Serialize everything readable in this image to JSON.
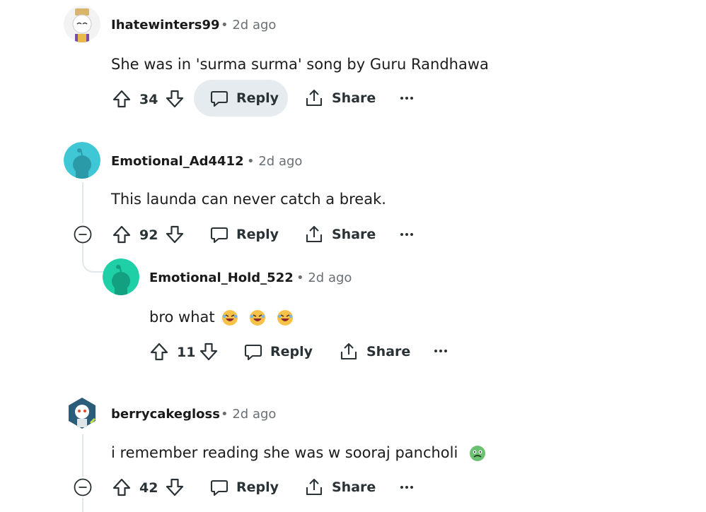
{
  "comments": [
    {
      "username": "Ihatewinters99",
      "time": "2d ago",
      "body": "She was in 'surma surma' song by Guru Randhawa",
      "votes": "34",
      "reply_label": "Reply",
      "share_label": "Share"
    },
    {
      "username": "Emotional_Ad4412",
      "time": "2d ago",
      "body": "This launda can never catch a break.",
      "votes": "92",
      "reply_label": "Reply",
      "share_label": "Share"
    },
    {
      "username": "Emotional_Hold_522",
      "time": "2d ago",
      "body": "bro what",
      "votes": "11",
      "reply_label": "Reply",
      "share_label": "Share"
    },
    {
      "username": "berrycakegloss",
      "time": "2d ago",
      "body": "i remember reading she was w sooraj pancholi",
      "votes": "42",
      "reply_label": "Reply",
      "share_label": "Share"
    }
  ],
  "meta_separator": "•",
  "colors": {
    "avatar_teal": "#3fc7d6",
    "avatar_green": "#1fd0a6",
    "reply_highlight": "#e5ebee",
    "thread_line": "#e3e6e8"
  },
  "icons": [
    "upvote-icon",
    "downvote-icon",
    "reply-icon",
    "share-icon",
    "more-icon",
    "collapse-icon",
    "laughing-emoji-icon",
    "nauseated-emoji-icon"
  ]
}
